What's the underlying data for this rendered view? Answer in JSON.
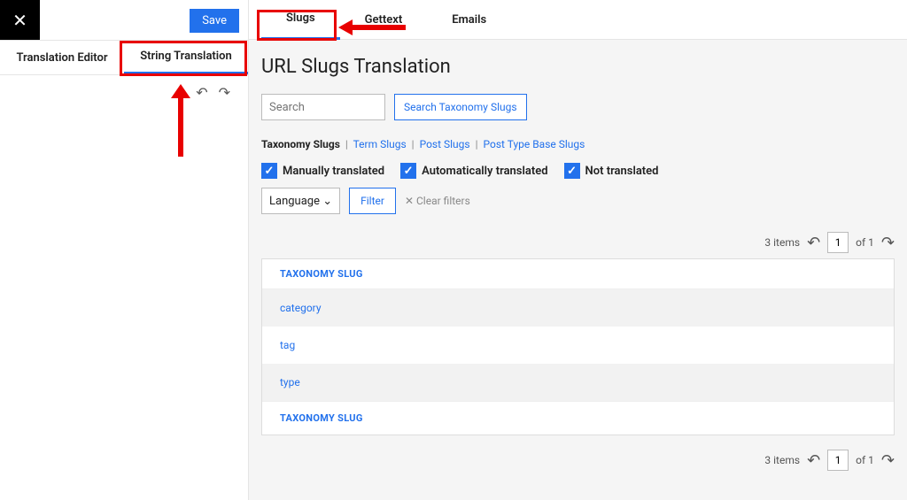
{
  "left": {
    "save_label": "Save",
    "tab_editor": "Translation Editor",
    "tab_string": "String Translation"
  },
  "top_tabs": {
    "slugs": "Slugs",
    "gettext": "Gettext",
    "emails": "Emails"
  },
  "page_title": "URL Slugs Translation",
  "search": {
    "placeholder": "Search",
    "button": "Search Taxonomy Slugs"
  },
  "subnav": {
    "active": "Taxonomy Slugs",
    "term": "Term Slugs",
    "post": "Post Slugs",
    "ptbase": "Post Type Base Slugs"
  },
  "checks": {
    "manual": "Manually translated",
    "auto": "Automatically translated",
    "not": "Not translated"
  },
  "filter": {
    "language": "Language",
    "button": "Filter",
    "clear": "Clear filters"
  },
  "pager": {
    "items": "3 items",
    "page_value": "1",
    "of": "of 1"
  },
  "table": {
    "header": "TAXONOMY SLUG",
    "rows": [
      "category",
      "tag",
      "type"
    ],
    "footer": "TAXONOMY SLUG"
  }
}
